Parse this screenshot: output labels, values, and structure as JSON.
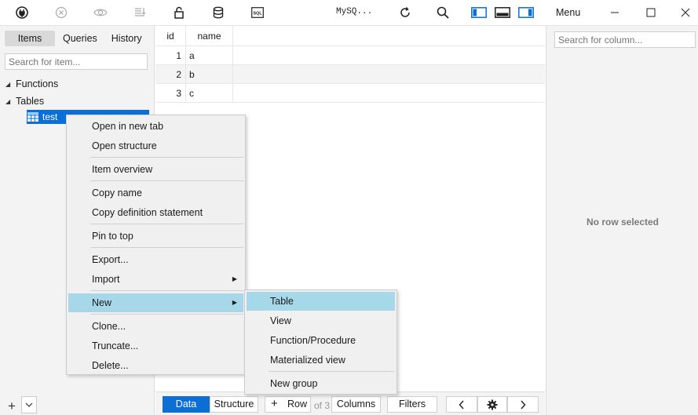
{
  "toolbar": {
    "connection_name": "MySQ...",
    "menu_label": "Menu",
    "icons": [
      "plug-icon",
      "cancel-icon",
      "eye-icon",
      "sort-icon",
      "lock-icon",
      "database-icon",
      "sql-icon",
      "refresh-icon",
      "search-icon",
      "layout-left-icon",
      "layout-bottom-icon",
      "layout-right-icon"
    ],
    "sql_text": "SQL"
  },
  "left": {
    "tabs": [
      {
        "label": "Items"
      },
      {
        "label": "Queries"
      },
      {
        "label": "History"
      }
    ],
    "search_placeholder": "Search for item...",
    "tree": {
      "functions": "Functions",
      "tables": "Tables",
      "table_item": "test"
    }
  },
  "grid": {
    "columns": [
      "id",
      "name"
    ],
    "rows": [
      {
        "id": "1",
        "name": "a"
      },
      {
        "id": "2",
        "name": "b"
      },
      {
        "id": "3",
        "name": "c"
      }
    ]
  },
  "bottom": {
    "data": "Data",
    "structure": "Structure",
    "row": "Row",
    "of": "of 3",
    "columns": "Columns",
    "filters": "Filters"
  },
  "right": {
    "search_placeholder": "Search for column...",
    "empty": "No row selected"
  },
  "context_menu": {
    "items": [
      "Open in new tab",
      "Open structure",
      "Item overview",
      "Copy name",
      "Copy definition statement",
      "Pin to top",
      "Export...",
      "Import",
      "New",
      "Clone...",
      "Truncate...",
      "Delete..."
    ],
    "highlighted": "New"
  },
  "submenu": {
    "items": [
      "Table",
      "View",
      "Function/Procedure",
      "Materialized view",
      "New group"
    ],
    "highlighted": "Table"
  },
  "colors": {
    "accent": "#0c6fd6",
    "menu_highlight": "#a7d8ea"
  }
}
